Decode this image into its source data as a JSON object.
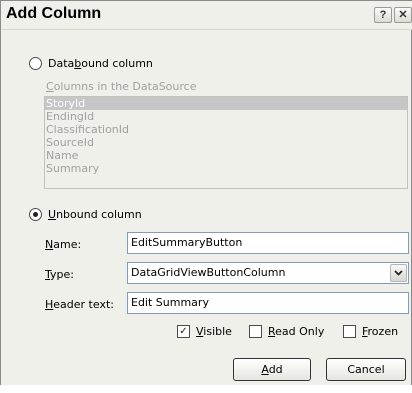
{
  "dialog": {
    "title": "Add Column",
    "help_glyph": "?",
    "close_glyph": "✕"
  },
  "databound": {
    "label_pre": "Data",
    "label_accel": "b",
    "label_post": "ound column",
    "selected": false,
    "columns_label_accel": "C",
    "columns_label_rest": "olumns in the DataSource",
    "columns": [
      "StoryId",
      "EndingId",
      "ClassificationId",
      "SourceId",
      "Name",
      "Summary"
    ],
    "selected_index": 0
  },
  "unbound": {
    "label_accel": "U",
    "label_rest": "nbound column",
    "selected": true
  },
  "fields": {
    "name_accel": "N",
    "name_rest": "ame:",
    "name_value": "EditSummaryButton",
    "type_accel": "T",
    "type_rest": "ype:",
    "type_value": "DataGridViewButtonColumn",
    "header_accel": "H",
    "header_rest": "eader text:",
    "header_value": "Edit Summary"
  },
  "options": {
    "visible_accel": "V",
    "visible_rest": "isible",
    "visible_checked": true,
    "readonly_accel": "R",
    "readonly_rest": "ead Only",
    "readonly_checked": false,
    "frozen_accel": "F",
    "frozen_rest": "rozen",
    "frozen_checked": false
  },
  "buttons": {
    "add_accel": "A",
    "add_rest": "dd",
    "cancel": "Cancel"
  },
  "icons": {
    "check": "✓",
    "dropdown": "chevron-down-icon"
  }
}
